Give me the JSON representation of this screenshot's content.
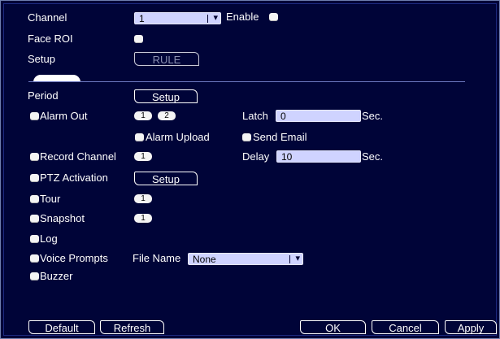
{
  "channel": {
    "label": "Channel",
    "value": "1",
    "enable_label": "Enable"
  },
  "face_roi": {
    "label": "Face ROI"
  },
  "setup": {
    "label": "Setup",
    "rule_button": "RULE"
  },
  "period": {
    "label": "Period",
    "button": "Setup"
  },
  "alarm_out": {
    "label": "Alarm Out",
    "outputs": [
      "1",
      "2"
    ],
    "latch_label": "Latch",
    "latch_value": "0",
    "latch_unit": "Sec."
  },
  "alarm_upload": {
    "label": "Alarm Upload"
  },
  "send_email": {
    "label": "Send Email"
  },
  "record_channel": {
    "label": "Record Channel",
    "value": "1",
    "delay_label": "Delay",
    "delay_value": "10",
    "delay_unit": "Sec."
  },
  "ptz_activation": {
    "label": "PTZ Activation",
    "button": "Setup"
  },
  "tour": {
    "label": "Tour",
    "value": "1"
  },
  "snapshot": {
    "label": "Snapshot",
    "value": "1"
  },
  "log": {
    "label": "Log"
  },
  "voice_prompts": {
    "label": "Voice Prompts",
    "file_name_label": "File Name",
    "file_name_value": "None"
  },
  "buzzer": {
    "label": "Buzzer"
  },
  "footer": {
    "default": "Default",
    "refresh": "Refresh",
    "ok": "OK",
    "cancel": "Cancel",
    "apply": "Apply"
  },
  "colors": {
    "background": "#000438",
    "field": "#cfd3ff",
    "text": "#ffffff"
  },
  "icons": {
    "dropdown": "chevron-down-icon"
  }
}
